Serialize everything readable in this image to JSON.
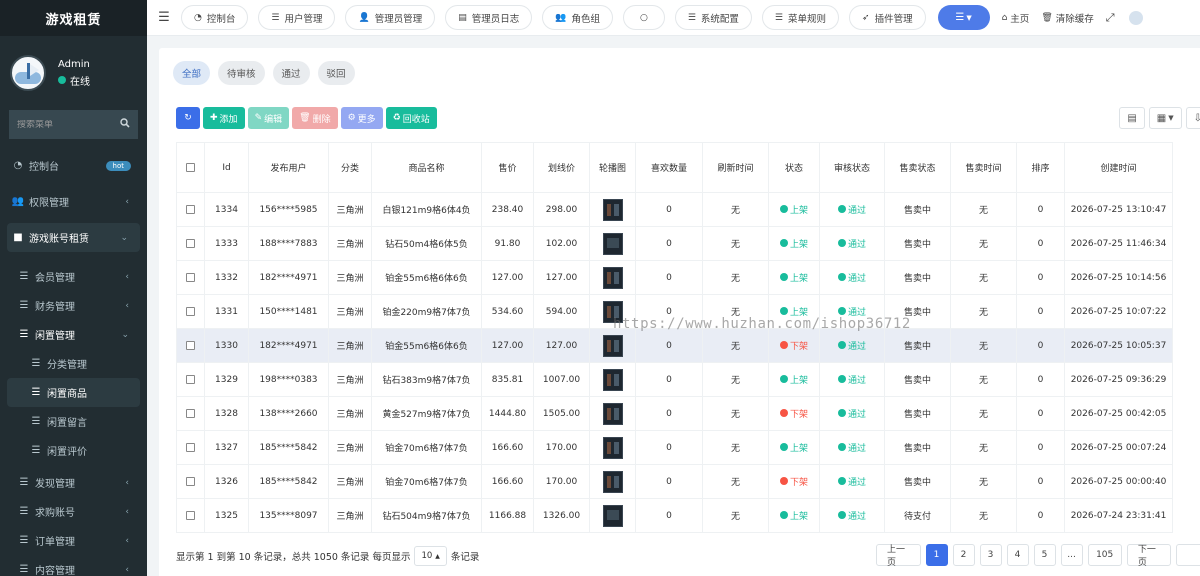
{
  "brand": "游戏租赁",
  "user": {
    "name": "Admin",
    "status": "在线"
  },
  "search": {
    "placeholder": "搜索菜单"
  },
  "menu": [
    {
      "label": "控制台",
      "icon": "dashboard-icon",
      "badge": "hot"
    },
    {
      "label": "权限管理",
      "icon": "users-icon",
      "arrow": "‹"
    },
    {
      "label": "游戏账号租赁",
      "icon": "folder-icon",
      "arrow": "⌄"
    },
    {
      "label": "会员管理",
      "arrow": "‹"
    },
    {
      "label": "财务管理",
      "arrow": "‹"
    },
    {
      "label": "闲置管理",
      "arrow": "⌄"
    },
    {
      "label": "分类管理"
    },
    {
      "label": "闲置商品"
    },
    {
      "label": "闲置留言"
    },
    {
      "label": "闲置评价"
    },
    {
      "label": "发现管理",
      "arrow": "‹"
    },
    {
      "label": "求购账号",
      "arrow": "‹"
    },
    {
      "label": "订单管理",
      "arrow": "‹"
    },
    {
      "label": "内容管理",
      "arrow": "‹"
    }
  ],
  "topbar": {
    "tabs": [
      {
        "label": "控制台",
        "icon": "dashboard-icon"
      },
      {
        "label": "用户管理",
        "icon": "list-icon"
      },
      {
        "label": "管理员管理",
        "icon": "user-icon"
      },
      {
        "label": "管理员日志",
        "icon": "log-icon"
      },
      {
        "label": "角色组",
        "icon": "group-icon"
      },
      {
        "label": "",
        "icon": "circle-icon"
      },
      {
        "label": "系统配置",
        "icon": "list-icon"
      },
      {
        "label": "菜单规则",
        "icon": "menu-icon"
      },
      {
        "label": "插件管理",
        "icon": "rocket-icon"
      }
    ],
    "home": "主页",
    "clear_cache": "清除缓存"
  },
  "subtabs": [
    "全部",
    "待审核",
    "通过",
    "驳回"
  ],
  "toolbar": {
    "add": "添加",
    "edit": "编辑",
    "delete": "删除",
    "more": "更多",
    "recycle": "回收站"
  },
  "table": {
    "columns": [
      "Id",
      "发布用户",
      "分类",
      "商品名称",
      "售价",
      "划线价",
      "轮播图",
      "喜欢数量",
      "刷新时间",
      "状态",
      "审核状态",
      "售卖状态",
      "售卖时间",
      "排序",
      "创建时间"
    ],
    "rows": [
      {
        "id": "1334",
        "user": "156****5985",
        "cat": "三角洲",
        "name": "白银121m9格6体4负",
        "price": "238.40",
        "orig": "298.00",
        "likes": "0",
        "refresh": "无",
        "status": "上架",
        "status_color": "green",
        "audit": "通过",
        "sale": "售卖中",
        "sale_time": "无",
        "sort": "0",
        "created": "2026-07-25 13:10:47",
        "thumb": "tall"
      },
      {
        "id": "1333",
        "user": "188****7883",
        "cat": "三角洲",
        "name": "钻石50m4格6体5负",
        "price": "91.80",
        "orig": "102.00",
        "likes": "0",
        "refresh": "无",
        "status": "上架",
        "status_color": "green",
        "audit": "通过",
        "sale": "售卖中",
        "sale_time": "无",
        "sort": "0",
        "created": "2026-07-25 11:46:34",
        "thumb": "wide"
      },
      {
        "id": "1332",
        "user": "182****4971",
        "cat": "三角洲",
        "name": "铂金55m6格6体6负",
        "price": "127.00",
        "orig": "127.00",
        "likes": "0",
        "refresh": "无",
        "status": "上架",
        "status_color": "green",
        "audit": "通过",
        "sale": "售卖中",
        "sale_time": "无",
        "sort": "0",
        "created": "2026-07-25 10:14:56",
        "thumb": "tall"
      },
      {
        "id": "1331",
        "user": "150****1481",
        "cat": "三角洲",
        "name": "铂金220m9格7体7负",
        "price": "534.60",
        "orig": "594.00",
        "likes": "0",
        "refresh": "无",
        "status": "上架",
        "status_color": "green",
        "audit": "通过",
        "sale": "售卖中",
        "sale_time": "无",
        "sort": "0",
        "created": "2026-07-25 10:07:22",
        "thumb": "tall"
      },
      {
        "id": "1330",
        "user": "182****4971",
        "cat": "三角洲",
        "name": "铂金55m6格6体6负",
        "price": "127.00",
        "orig": "127.00",
        "likes": "0",
        "refresh": "无",
        "status": "下架",
        "status_color": "red",
        "audit": "通过",
        "sale": "售卖中",
        "sale_time": "无",
        "sort": "0",
        "created": "2026-07-25 10:05:37",
        "thumb": "tall"
      },
      {
        "id": "1329",
        "user": "198****0383",
        "cat": "三角洲",
        "name": "钻石383m9格7体7负",
        "price": "835.81",
        "orig": "1007.00",
        "likes": "0",
        "refresh": "无",
        "status": "上架",
        "status_color": "green",
        "audit": "通过",
        "sale": "售卖中",
        "sale_time": "无",
        "sort": "0",
        "created": "2026-07-25 09:36:29",
        "thumb": "tall"
      },
      {
        "id": "1328",
        "user": "138****2660",
        "cat": "三角洲",
        "name": "黄金527m9格7体7负",
        "price": "1444.80",
        "orig": "1505.00",
        "likes": "0",
        "refresh": "无",
        "status": "下架",
        "status_color": "red",
        "audit": "通过",
        "sale": "售卖中",
        "sale_time": "无",
        "sort": "0",
        "created": "2026-07-25 00:42:05",
        "thumb": "tall"
      },
      {
        "id": "1327",
        "user": "185****5842",
        "cat": "三角洲",
        "name": "铂金70m6格7体7负",
        "price": "166.60",
        "orig": "170.00",
        "likes": "0",
        "refresh": "无",
        "status": "上架",
        "status_color": "green",
        "audit": "通过",
        "sale": "售卖中",
        "sale_time": "无",
        "sort": "0",
        "created": "2026-07-25 00:07:24",
        "thumb": "tall"
      },
      {
        "id": "1326",
        "user": "185****5842",
        "cat": "三角洲",
        "name": "铂金70m6格7体7负",
        "price": "166.60",
        "orig": "170.00",
        "likes": "0",
        "refresh": "无",
        "status": "下架",
        "status_color": "red",
        "audit": "通过",
        "sale": "售卖中",
        "sale_time": "无",
        "sort": "0",
        "created": "2026-07-25 00:00:40",
        "thumb": "tall"
      },
      {
        "id": "1325",
        "user": "135****8097",
        "cat": "三角洲",
        "name": "钻石504m9格7体7负",
        "price": "1166.88",
        "orig": "1326.00",
        "likes": "0",
        "refresh": "无",
        "status": "上架",
        "status_color": "green",
        "audit": "通过",
        "sale": "待支付",
        "sale_time": "无",
        "sort": "0",
        "created": "2026-07-24 23:31:41",
        "thumb": "wide"
      }
    ]
  },
  "footer": {
    "info_prefix": "显示第 1 到第 10 条记录，总共 1050 条记录 每页显示",
    "per_page": "10",
    "info_suffix": "条记录",
    "prev": "上一页",
    "pages": [
      "1",
      "2",
      "3",
      "4",
      "5",
      "...",
      "105"
    ],
    "next": "下一页"
  },
  "watermark": "https://www.huzhan.com/ishop36712",
  "colors": {
    "sidebar": "#222d32",
    "primary": "#3b6ee8",
    "success": "#18bc9c",
    "danger": "#f75444"
  }
}
